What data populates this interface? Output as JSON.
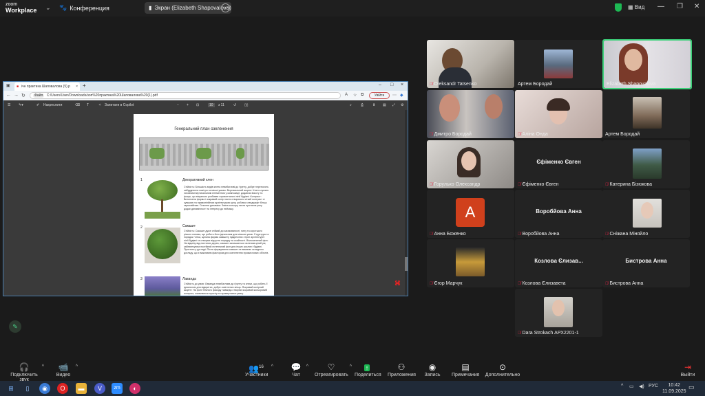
{
  "topbar": {
    "logo_line1": "zoom",
    "logo_line2": "Workplace",
    "chevron": "⌄",
    "conference_label": "Конференция",
    "share_label": "Экран (Elizabeth Shapovalova)",
    "share_more": "···",
    "view_label": "Вид",
    "accent_color": "#1db954"
  },
  "browser": {
    "tab_title": "ічн практика Шаповалова (5).p",
    "tab_close": "×",
    "new_tab": "+",
    "file_chip": "Файл",
    "url": "C:/Users/User/Downloads/зоп%20практика%20Шаповалова%20(1).pdf",
    "login_label": "Увійти",
    "pdf_toolbar": {
      "draw_label": "Накреслити",
      "copilot_label": "Запитати в Copilot",
      "zoom_minus": "−",
      "zoom_plus": "+",
      "page_current": "10",
      "page_total": "з 11"
    }
  },
  "pdf": {
    "page_title": "Генеральний план озеленення",
    "sections": [
      {
        "num": "1",
        "title": "Декоративний клен",
        "text": "Стійкість: Більшість видів клена невибагливі до ґрунту, добре переносять забруднення повітря та міські умови. Вертикальний акцент: Клен служить головним вертикальним елементом у композиції, додаючи висоту та фокус, що візуально розбиває горизонтальні лінії будівлі. Контраст: Витончена форма і яскравий колір листя створюють чіткий контраст зі суворою та прямолінійною архітектурою цеху, роблячи ландшафт більш гармонійним. Сезонна динаміка: Зміна кольору листя протягом року додає динамічності та інтересу до пейзажу."
      },
      {
        "num": "2",
        "title": "Самшит",
        "text": "Стійкість: Самшит дуже стійкий до загазованості, пилу та коротшого різкого полива, що робить його ідеальним для міських умов. Структура та порядок: Чітка, щільна форма самшиту підкреслює строгі архітектурні лінії будівлі та створює відчуття порядку та охайності. Вічнозелений фон: На відміну від листяних дерев, самшит залишається зеленим цілий рік, забезпечуючи постійний естетичний фон для інших рослин і будівлі. Простота у догляді: Після формування самшит не вимагає складного догляду, що є важливим фактором для озеленення промислових об'єктів."
      },
      {
        "num": "3",
        "title": "Лаванда",
        "text": "Стійкість до умов: Лаванда невибаглива до ґрунту та спеки, що робить її ідеальною для відкритих, добре освітлених місць. Яскравий колірний акцент: На фоні темного фасаду лаванда створює яскравий кольоровий контраст, оживлюючи простір та привертаючи увагу."
      }
    ]
  },
  "participants": [
    {
      "name": "Oleksandr Tatsenko",
      "muted": true,
      "video": true
    },
    {
      "name": "Артем Бородай",
      "muted": false,
      "video": true
    },
    {
      "name": "Elizabeth Shapovalova",
      "muted": false,
      "video": true,
      "active": true
    },
    {
      "name": "Дмитро Бородай",
      "muted": true,
      "video": true
    },
    {
      "name": "Аліна Онда",
      "muted": true,
      "video": true
    },
    {
      "name": "Артем Бородай",
      "muted": false,
      "video": true
    },
    {
      "name": "Горулько Олександр",
      "muted": true,
      "video": true
    },
    {
      "name": "Єфіменко Євген",
      "muted": true,
      "video": false,
      "big": "Єфіменко Євген"
    },
    {
      "name": "Катерина Бізюкова",
      "muted": true,
      "video": true
    },
    {
      "name": "Анна Боженко",
      "muted": true,
      "video": false,
      "avatar": "A"
    },
    {
      "name": "Воробйова Анна",
      "muted": true,
      "video": false,
      "big": "Воробйова Анна"
    },
    {
      "name": "Сніжана Міняйло",
      "muted": true,
      "video": true
    },
    {
      "name": "Єгор Марчук",
      "muted": true,
      "video": true
    },
    {
      "name": "Козлова Єлизавета",
      "muted": true,
      "video": false,
      "big": "Козлова Єлизав..."
    },
    {
      "name": "Бистрова Анна",
      "muted": true,
      "video": false,
      "big": "Бистрова Анна"
    },
    {
      "name": "Dara Strokach АРХ2201-1",
      "muted": true,
      "video": true
    }
  ],
  "toolbar": {
    "audio": "Подключить звук",
    "video": "Видео",
    "participants": "Участники",
    "participants_count": "16",
    "chat": "Чат",
    "react": "Отреагировать",
    "share": "Поделиться",
    "apps": "Приложения",
    "record": "Запись",
    "notes": "Примечания",
    "more": "Дополнительно",
    "exit": "Выйти"
  },
  "taskbar": {
    "lang": "РУС",
    "time": "10:42",
    "date": "11.09.2025"
  }
}
